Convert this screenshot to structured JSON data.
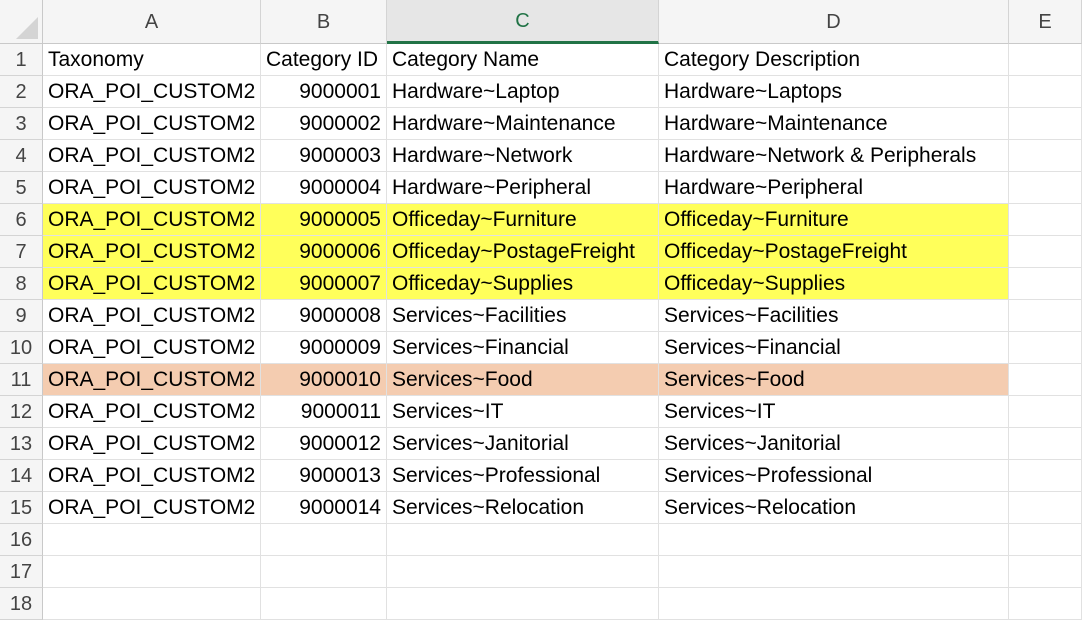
{
  "columns": [
    "A",
    "B",
    "C",
    "D",
    "E"
  ],
  "selected_column": "C",
  "row_numbers": [
    "1",
    "2",
    "3",
    "4",
    "5",
    "6",
    "7",
    "8",
    "9",
    "10",
    "11",
    "12",
    "13",
    "14",
    "15",
    "16",
    "17",
    "18"
  ],
  "colors": {
    "highlight_yellow": "#ffff5a",
    "highlight_peach": "#f4ccb0",
    "selected_header_accent": "#217346"
  },
  "rows": [
    {
      "cells": [
        "Taxonomy",
        "Category ID",
        "Category Name",
        "Category Description",
        ""
      ],
      "highlight": ""
    },
    {
      "cells": [
        "ORA_POI_CUSTOM2",
        "9000001",
        "Hardware~Laptop",
        "Hardware~Laptops",
        ""
      ],
      "highlight": ""
    },
    {
      "cells": [
        "ORA_POI_CUSTOM2",
        "9000002",
        "Hardware~Maintenance",
        "Hardware~Maintenance",
        ""
      ],
      "highlight": ""
    },
    {
      "cells": [
        "ORA_POI_CUSTOM2",
        "9000003",
        "Hardware~Network",
        "Hardware~Network & Peripherals",
        ""
      ],
      "highlight": ""
    },
    {
      "cells": [
        "ORA_POI_CUSTOM2",
        "9000004",
        "Hardware~Peripheral",
        "Hardware~Peripheral",
        ""
      ],
      "highlight": ""
    },
    {
      "cells": [
        "ORA_POI_CUSTOM2",
        "9000005",
        "Officeday~Furniture",
        "Officeday~Furniture",
        ""
      ],
      "highlight": "yellow"
    },
    {
      "cells": [
        "ORA_POI_CUSTOM2",
        "9000006",
        "Officeday~PostageFreight",
        "Officeday~PostageFreight",
        ""
      ],
      "highlight": "yellow"
    },
    {
      "cells": [
        "ORA_POI_CUSTOM2",
        "9000007",
        "Officeday~Supplies",
        "Officeday~Supplies",
        ""
      ],
      "highlight": "yellow"
    },
    {
      "cells": [
        "ORA_POI_CUSTOM2",
        "9000008",
        "Services~Facilities",
        "Services~Facilities",
        ""
      ],
      "highlight": ""
    },
    {
      "cells": [
        "ORA_POI_CUSTOM2",
        "9000009",
        "Services~Financial",
        "Services~Financial",
        ""
      ],
      "highlight": ""
    },
    {
      "cells": [
        "ORA_POI_CUSTOM2",
        "9000010",
        "Services~Food",
        "Services~Food",
        ""
      ],
      "highlight": "peach"
    },
    {
      "cells": [
        "ORA_POI_CUSTOM2",
        "9000011",
        "Services~IT",
        "Services~IT",
        ""
      ],
      "highlight": ""
    },
    {
      "cells": [
        "ORA_POI_CUSTOM2",
        "9000012",
        "Services~Janitorial",
        "Services~Janitorial",
        ""
      ],
      "highlight": ""
    },
    {
      "cells": [
        "ORA_POI_CUSTOM2",
        "9000013",
        "Services~Professional",
        "Services~Professional",
        ""
      ],
      "highlight": ""
    },
    {
      "cells": [
        "ORA_POI_CUSTOM2",
        "9000014",
        "Services~Relocation",
        "Services~Relocation",
        ""
      ],
      "highlight": ""
    },
    {
      "cells": [
        "",
        "",
        "",
        "",
        ""
      ],
      "highlight": ""
    },
    {
      "cells": [
        "",
        "",
        "",
        "",
        ""
      ],
      "highlight": ""
    },
    {
      "cells": [
        "",
        "",
        "",
        "",
        ""
      ],
      "highlight": ""
    }
  ]
}
